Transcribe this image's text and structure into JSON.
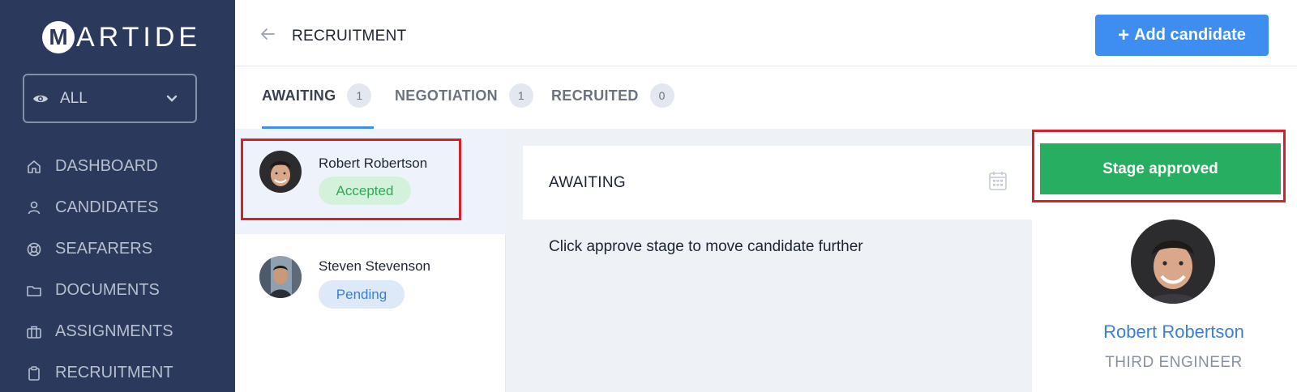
{
  "sidebar": {
    "logo": {
      "mark": "M",
      "text": "ARTIDE"
    },
    "filter": {
      "value": "ALL"
    },
    "items": [
      {
        "label": "DASHBOARD",
        "icon": "home-icon"
      },
      {
        "label": "CANDIDATES",
        "icon": "user-icon"
      },
      {
        "label": "SEAFARERS",
        "icon": "lifebuoy-icon"
      },
      {
        "label": "DOCUMENTS",
        "icon": "folder-icon"
      },
      {
        "label": "ASSIGNMENTS",
        "icon": "briefcase-icon"
      },
      {
        "label": "RECRUITMENT",
        "icon": "clipboard-icon"
      }
    ]
  },
  "header": {
    "title": "RECRUITMENT",
    "add_button": {
      "plus": "+",
      "label": "Add candidate"
    }
  },
  "tabs": [
    {
      "label": "AWAITING",
      "count": "1",
      "active": true
    },
    {
      "label": "NEGOTIATION",
      "count": "1",
      "active": false
    },
    {
      "label": "RECRUITED",
      "count": "0",
      "active": false
    }
  ],
  "candidates": [
    {
      "name": "Robert Robertson",
      "status": "Accepted",
      "selected": true
    },
    {
      "name": "Steven Stevenson",
      "status": "Pending",
      "selected": false
    }
  ],
  "stage": {
    "title": "AWAITING",
    "message": "Click approve stage to move candidate further",
    "approve_label": "Stage approved"
  },
  "profile": {
    "name": "Robert Robertson",
    "role": "THIRD ENGINEER"
  },
  "colors": {
    "sidebar": "#2b3a5c",
    "accent": "#3d8ef0",
    "approve": "#27ae60",
    "highlight": "#d3222a"
  }
}
